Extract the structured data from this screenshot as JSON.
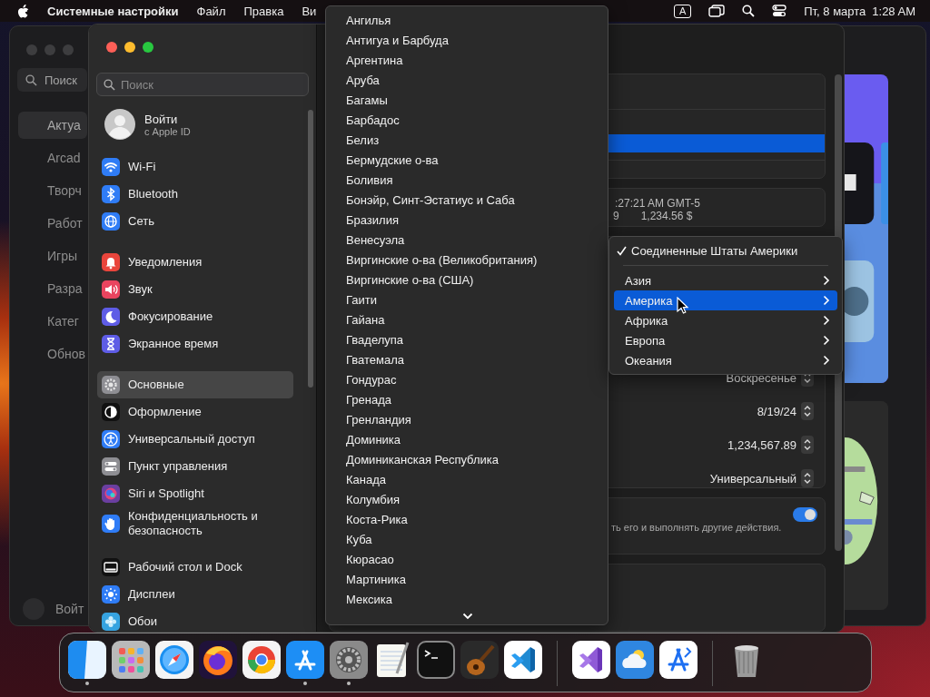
{
  "menubar": {
    "app_name": "Системные настройки",
    "menus": [
      "Файл",
      "Правка",
      "Ви"
    ],
    "input_source": "A",
    "date": "Пт, 8 марта",
    "time": "1:28 AM"
  },
  "back_window": {
    "search_placeholder": "Поиск",
    "items": [
      {
        "label": "Актуа",
        "selected": true
      },
      {
        "label": "Arcad",
        "selected": false
      },
      {
        "label": "Творч",
        "selected": false
      },
      {
        "label": "Работ",
        "selected": false
      },
      {
        "label": "Игры",
        "selected": false
      },
      {
        "label": "Разра",
        "selected": false
      },
      {
        "label": "Катег",
        "selected": false
      },
      {
        "label": "Обнов",
        "selected": false
      }
    ],
    "account": "Войт"
  },
  "settings": {
    "search_placeholder": "Поиск",
    "account": {
      "title": "Войти",
      "subtitle": "с Apple ID"
    },
    "groups": [
      [
        {
          "label": "Wi-Fi",
          "color": "#2f7cf6",
          "selected": false
        },
        {
          "label": "Bluetooth",
          "color": "#2f7cf6",
          "selected": false
        },
        {
          "label": "Сеть",
          "color": "#2f7cf6",
          "selected": false
        }
      ],
      [
        {
          "label": "Уведомления",
          "color": "#e9453c",
          "selected": false
        },
        {
          "label": "Звук",
          "color": "#e9445f",
          "selected": false
        },
        {
          "label": "Фокусирование",
          "color": "#5e5ce6",
          "selected": false
        },
        {
          "label": "Экранное время",
          "color": "#5e5ce6",
          "selected": false
        }
      ],
      [
        {
          "label": "Основные",
          "color": "#8e8e93",
          "selected": true
        },
        {
          "label": "Оформление",
          "color": "#111111",
          "selected": false
        },
        {
          "label": "Универсальный доступ",
          "color": "#2f7cf6",
          "selected": false
        },
        {
          "label": "Пункт управления",
          "color": "#8e8e93",
          "selected": false
        },
        {
          "label": "Siri и Spotlight",
          "color": "#6b3fa0",
          "selected": false
        },
        {
          "label": "Конфиденциальность и безопасность",
          "color": "#2f7cf6",
          "selected": false
        }
      ],
      [
        {
          "label": "Рабочий стол и Dock",
          "color": "#111111",
          "selected": false
        },
        {
          "label": "Дисплеи",
          "color": "#2f7cf6",
          "selected": false
        },
        {
          "label": "Обои",
          "color": "#36a3e0",
          "selected": false
        }
      ]
    ],
    "list_rows": [
      {
        "selected": false
      },
      {
        "selected": true
      },
      {
        "selected": false
      }
    ],
    "format_preview": {
      "time": ":27:21 AM GMT-5",
      "date": "9",
      "currency": "1,234.56 $"
    },
    "popups": [
      {
        "value": "Воскресенье"
      },
      {
        "value": "8/19/24"
      },
      {
        "value": "1,234,567.89"
      },
      {
        "value": "Универсальный"
      }
    ],
    "toggle": {
      "description": "ть его и выполнять другие действия.",
      "on": true
    }
  },
  "country_list": [
    "Ангилья",
    "Антигуа и Барбуда",
    "Аргентина",
    "Аруба",
    "Багамы",
    "Барбадос",
    "Белиз",
    "Бермудские о-ва",
    "Боливия",
    "Бонэйр, Синт-Эстатиус и Саба",
    "Бразилия",
    "Венесуэла",
    "Виргинские о-ва (Великобритания)",
    "Виргинские о-ва (США)",
    "Гаити",
    "Гайана",
    "Гваделупа",
    "Гватемала",
    "Гондурас",
    "Гренада",
    "Гренландия",
    "Доминика",
    "Доминиканская Республика",
    "Канада",
    "Колумбия",
    "Коста-Рика",
    "Куба",
    "Кюрасао",
    "Мартиника",
    "Мексика"
  ],
  "region_menu": {
    "current": {
      "label": "Соединенные Штаты Америки",
      "checked": true
    },
    "regions": [
      {
        "label": "Азия",
        "selected": false
      },
      {
        "label": "Америка",
        "selected": true
      },
      {
        "label": "Африка",
        "selected": false
      },
      {
        "label": "Европа",
        "selected": false
      },
      {
        "label": "Океания",
        "selected": false
      }
    ]
  },
  "dock": {
    "apps": [
      {
        "running": true
      },
      {
        "running": false
      },
      {
        "running": false
      },
      {
        "running": false
      },
      {
        "running": false
      },
      {
        "running": true
      },
      {
        "running": true
      },
      {
        "running": false
      },
      {
        "running": false
      },
      {
        "running": false
      },
      {
        "running": false
      }
    ],
    "recent_apps": [
      {
        "running": false
      },
      {
        "running": false
      },
      {
        "running": false
      }
    ]
  }
}
